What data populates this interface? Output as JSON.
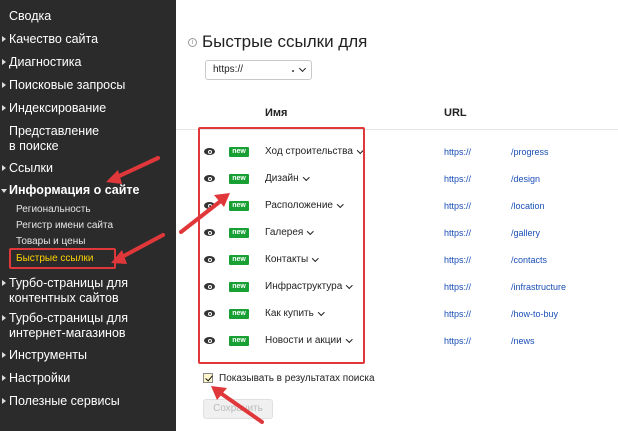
{
  "sidebar": {
    "items": [
      {
        "label": "Сводка"
      },
      {
        "label": "Качество сайта"
      },
      {
        "label": "Диагностика"
      },
      {
        "label": "Поисковые запросы"
      },
      {
        "label": "Индексирование"
      },
      {
        "label": "Представление\nв поиске"
      },
      {
        "label": "Ссылки"
      },
      {
        "label": "Информация о сайте"
      },
      {
        "label": "Турбо-страницы для\nконтентных сайтов"
      },
      {
        "label": "Турбо-страницы для\nинтернет-магазинов"
      },
      {
        "label": "Инструменты"
      },
      {
        "label": "Настройки"
      },
      {
        "label": "Полезные сервисы"
      }
    ],
    "subitems": [
      {
        "label": "Региональность"
      },
      {
        "label": "Регистр имени сайта"
      },
      {
        "label": "Товары и цены"
      },
      {
        "label": "Быстрые ссылки",
        "active": true
      }
    ]
  },
  "main": {
    "title": "Быстрые ссылки для",
    "info_icon": "i",
    "site_select": {
      "value": "https://"
    },
    "columns": {
      "name": "Имя",
      "url": "URL"
    },
    "badge_label": "new",
    "links": [
      {
        "name": "Ход строительства",
        "url_prefix": "https://",
        "url_path": "/progress"
      },
      {
        "name": "Дизайн",
        "url_prefix": "https://",
        "url_path": "/design"
      },
      {
        "name": "Расположение",
        "url_prefix": "https://",
        "url_path": "/location"
      },
      {
        "name": "Галерея",
        "url_prefix": "https://",
        "url_path": "/gallery"
      },
      {
        "name": "Контакты",
        "url_prefix": "https://",
        "url_path": "/contacts"
      },
      {
        "name": "Инфраструктура",
        "url_prefix": "https://",
        "url_path": "/infrastructure"
      },
      {
        "name": "Как купить",
        "url_prefix": "https://",
        "url_path": "/how-to-buy"
      },
      {
        "name": "Новости и акции",
        "url_prefix": "https://",
        "url_path": "/news"
      }
    ],
    "show_in_search": {
      "label": "Показывать в результатах поиска",
      "checked": true
    },
    "save_label": "Сохранить"
  },
  "colors": {
    "sidebar_bg": "#2b2b2b",
    "active_sub": "#ffd400",
    "annotation_red": "#e0383a",
    "badge_green": "#18a034",
    "link_blue": "#1a4fb6"
  }
}
